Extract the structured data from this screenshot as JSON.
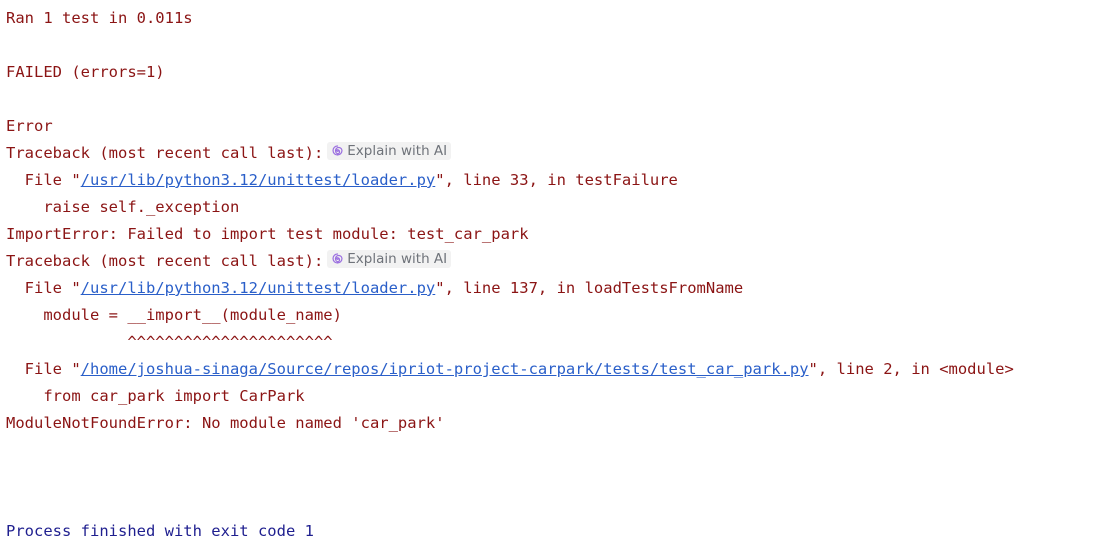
{
  "console": {
    "ran_line": "Ran 1 test in 0.011s",
    "failed_line": "FAILED (errors=1)",
    "error_line": "Error",
    "traceback1": {
      "text": "Traceback (most recent call last):",
      "ai_label": "Explain with AI"
    },
    "frame1": {
      "prefix": "  File \"",
      "path": "/usr/lib/python3.12/unittest/loader.py",
      "suffix": "\", line 33, in testFailure"
    },
    "code1": "    raise self._exception",
    "import_error": "ImportError: Failed to import test module: test_car_park",
    "traceback2": {
      "text": "Traceback (most recent call last):",
      "ai_label": "Explain with AI"
    },
    "frame2": {
      "prefix": "  File \"",
      "path": "/usr/lib/python3.12/unittest/loader.py",
      "suffix": "\", line 137, in loadTestsFromName"
    },
    "code2": "    module = __import__(module_name)",
    "carets": "             ^^^^^^^^^^^^^^^^^^^^^^",
    "frame3": {
      "prefix": "  File \"",
      "path": "/home/joshua-sinaga/Source/repos/ipriot-project-carpark/tests/test_car_park.py",
      "suffix": "\", line 2, in <module>"
    },
    "code3": "    from car_park import CarPark",
    "module_error": "ModuleNotFoundError: No module named 'car_park'",
    "process_finished": "Process finished with exit code 1"
  },
  "colors": {
    "error_text": "#8b1414",
    "link": "#2a5fc9",
    "process_text": "#1f1f8f",
    "ai_icon": "#9b6fe0"
  },
  "icons": {
    "ai": "ai-spiral-icon"
  }
}
